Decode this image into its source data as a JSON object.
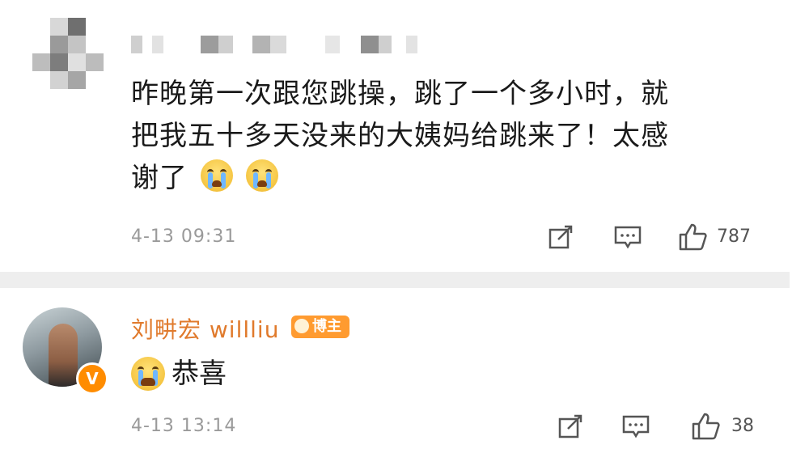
{
  "comment1": {
    "text_line1": "昨晚第一次跟您跳操，跳了一个多小时，就",
    "text_line2": "把我五十多天没来的大姨妈给跳来了！太感",
    "text_line3": "谢了",
    "emojis": [
      "crying-face",
      "crying-face"
    ],
    "time": "4-13 09:31",
    "likes": "787"
  },
  "comment2": {
    "author": "刘畊宏 willliu",
    "badge": "博主",
    "verified_mark": "V",
    "emoji": "joyful-crying-face",
    "text": "恭喜",
    "time": "4-13 13:14",
    "likes": "38"
  },
  "colors": {
    "author": "#e07a2c",
    "badge": "#ff9b30",
    "meta": "#9a9a9a",
    "divider": "#eeeeee"
  }
}
